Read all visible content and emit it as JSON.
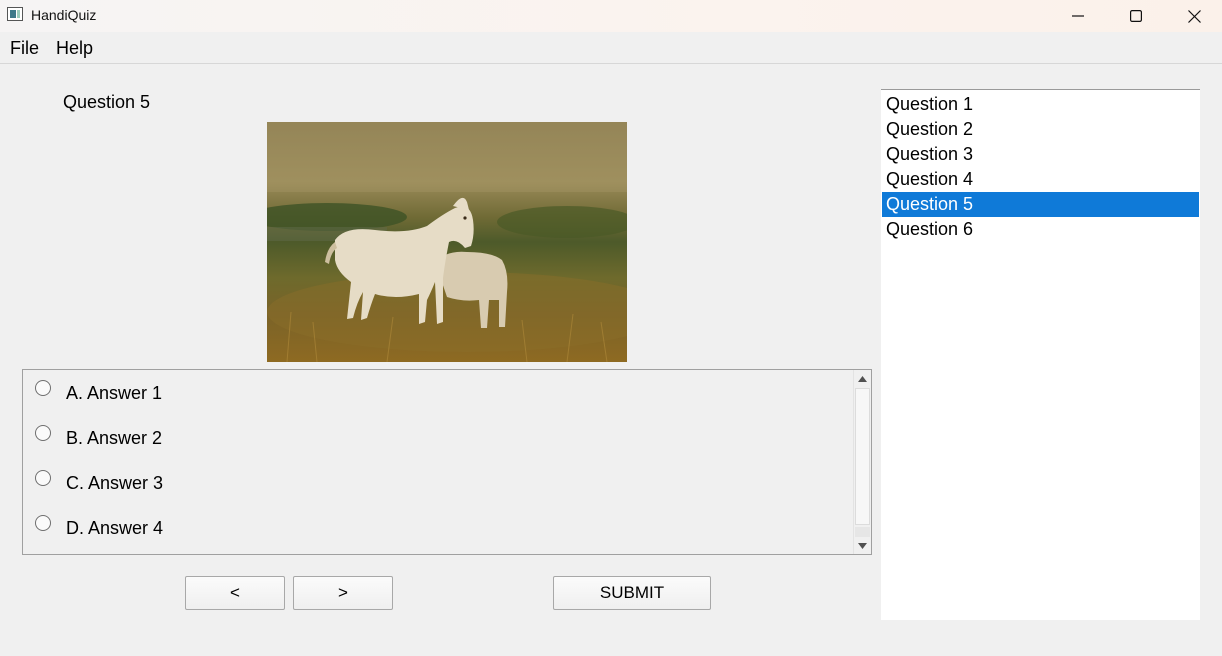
{
  "window": {
    "title": "HandiQuiz"
  },
  "menu": [
    "File",
    "Help"
  ],
  "question": {
    "label": "Question 5",
    "image": "white-horse-and-foal-photo"
  },
  "answers": [
    {
      "label": "A. Answer 1",
      "selected": false
    },
    {
      "label": "B. Answer 2",
      "selected": false
    },
    {
      "label": "C. Answer 3",
      "selected": false
    },
    {
      "label": "D. Answer 4",
      "selected": false
    }
  ],
  "buttons": {
    "prev": "<",
    "next": ">",
    "submit": "SUBMIT"
  },
  "question_list": {
    "items": [
      "Question 1",
      "Question 2",
      "Question 3",
      "Question 4",
      "Question 5",
      "Question 6"
    ],
    "selected_index": 4
  },
  "colors": {
    "selection": "#0f7ad8"
  },
  "icons": [
    "app-icon",
    "minimize-icon",
    "maximize-icon",
    "close-icon",
    "scroll-up-icon",
    "scroll-down-icon"
  ]
}
